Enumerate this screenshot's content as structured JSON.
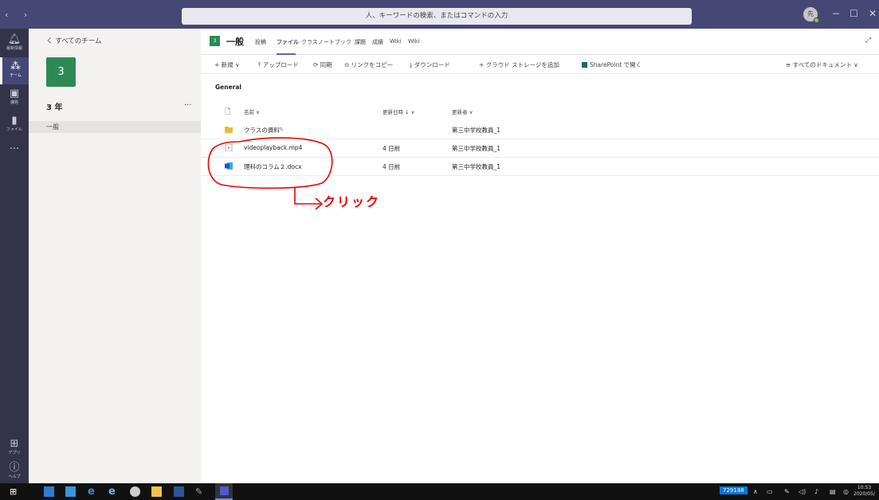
{
  "titlebar": {
    "nav": "‹ ›",
    "search_placeholder": "人、キーワードの検索、またはコマンドの入力",
    "profile_initial": "先",
    "min": "−",
    "max": "☐",
    "close": "✕"
  },
  "rail": {
    "items": [
      {
        "label": "最新情報"
      },
      {
        "label": "チーム"
      },
      {
        "label": "課題"
      },
      {
        "label": "ファイル"
      },
      {
        "label": "..."
      }
    ],
    "apps": "アプリ",
    "help": "ヘルプ"
  },
  "panel": {
    "back": "く すべてのチーム",
    "team_tile": "3",
    "team_name": "3 年",
    "more": "...",
    "channel": "一般"
  },
  "header": {
    "tile": "3",
    "title": "一般",
    "tabs": [
      "投稿",
      "ファイル",
      "クラスノートブック",
      "課題",
      "成績",
      "Wiki",
      "Wiki"
    ],
    "expand": "⤢"
  },
  "toolbar": {
    "new": "+ 新規 ∨",
    "upload": "⤒ アップロード",
    "sync": "⟳ 同期",
    "copy_link": "⊝ リンクをコピー",
    "download": "⤓ ダウンロード",
    "add_storage": "+ クラウド ストレージを追加",
    "sharepoint": "SharePoint で開く",
    "all_docs": "≡ すべてのドキュメント ∨"
  },
  "breadcrumb": "General",
  "columns": {
    "name": "名前 ∨",
    "modified": "更新日時 ↓ ∨",
    "modified_by": "更新者 ∨"
  },
  "files": [
    {
      "name": "クラスの資料",
      "modified": "",
      "by": "第三中学校教員_1",
      "type": "folder"
    },
    {
      "name": "videoplayback.mp4",
      "modified": "4 日前",
      "by": "第三中学校教員_1",
      "type": "video"
    },
    {
      "name": "理科のコラム２.docx",
      "modified": "4 日前",
      "by": "第三中学校教員_1",
      "type": "word"
    }
  ],
  "annotation": {
    "text": "クリック",
    "color": "#e00000"
  },
  "taskbar": {
    "ime": "729188",
    "time": "10:53",
    "date": "2020/05/"
  },
  "colors": {
    "brand": "#464775",
    "rail": "#33344a",
    "team": "#2d8a56"
  }
}
